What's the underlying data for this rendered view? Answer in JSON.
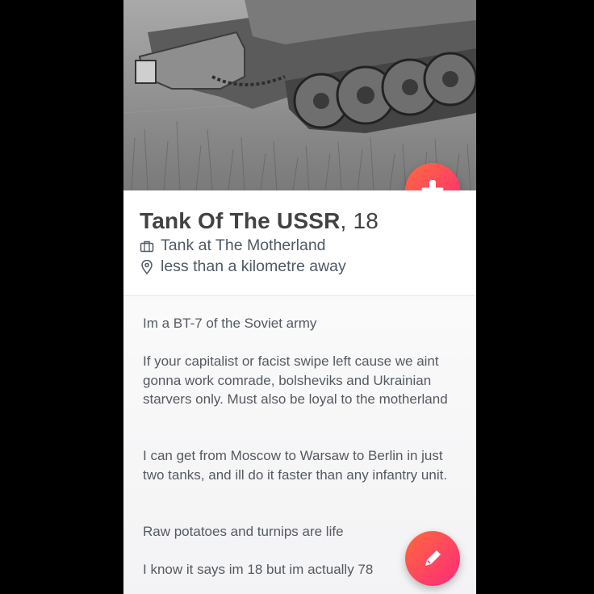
{
  "profile": {
    "name": "Tank Of The USSR",
    "age_text": ", 18",
    "job": "Tank at The Motherland",
    "distance": "less than a kilometre away",
    "photo_icon": "tank-photo"
  },
  "bio": {
    "p1": "Im a BT-7 of the Soviet army",
    "p2": "If your capitalist or facist swipe left cause we aint gonna work comrade, bolsheviks and Ukrainian starvers only. Must also be loyal to the motherland",
    "p3": "I can get from Moscow to Warsaw to Berlin in just two tanks, and ill do it faster than any infantry unit.",
    "p4": "Raw potatoes and turnips are life",
    "p5": "I know it says im 18 but im actually 78"
  },
  "actions": {
    "collapse_icon": "arrow-down-icon",
    "edit_icon": "pencil-icon"
  },
  "colors": {
    "accent_start": "#ff6a3d",
    "accent_end": "#fd297b",
    "text": "#424242",
    "subtext": "#505965"
  }
}
